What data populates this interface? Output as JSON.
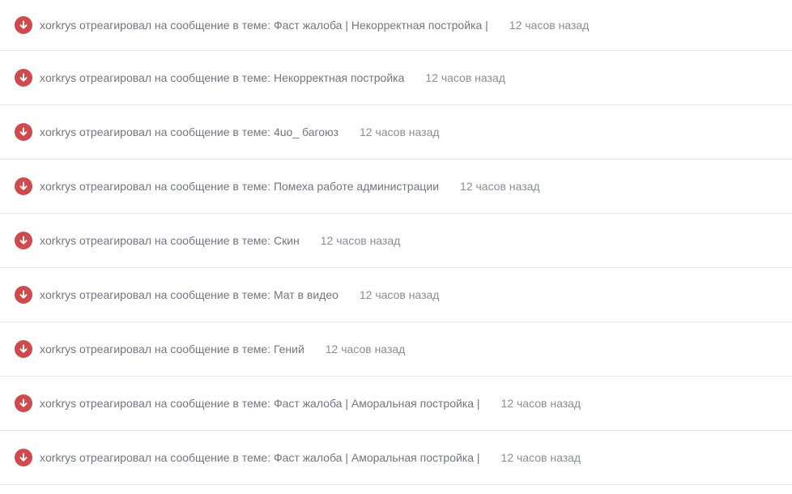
{
  "alerts": [
    {
      "icon": "down-arrow-icon",
      "text": "xorkrys отреагировал на сообщение в теме: Фаст жалоба | Некорректная постройка |",
      "time": "12 часов назад"
    },
    {
      "icon": "down-arrow-icon",
      "text": "xorkrys отреагировал на сообщение в теме: Некорректная постройка",
      "time": "12 часов назад"
    },
    {
      "icon": "down-arrow-icon",
      "text": "xorkrys отреагировал на сообщение в теме: 4uo_ багоюз",
      "time": "12 часов назад"
    },
    {
      "icon": "down-arrow-icon",
      "text": "xorkrys отреагировал на сообщение в теме: Помеха работе администрации",
      "time": "12 часов назад"
    },
    {
      "icon": "down-arrow-icon",
      "text": "xorkrys отреагировал на сообщение в теме: Скин",
      "time": "12 часов назад"
    },
    {
      "icon": "down-arrow-icon",
      "text": "xorkrys отреагировал на сообщение в теме: Мат в видео",
      "time": "12 часов назад"
    },
    {
      "icon": "down-arrow-icon",
      "text": "xorkrys отреагировал на сообщение в теме: Гений",
      "time": "12 часов назад"
    },
    {
      "icon": "down-arrow-icon",
      "text": "xorkrys отреагировал на сообщение в теме: Фаст жалоба | Аморальная постройка |",
      "time": "12 часов назад"
    },
    {
      "icon": "down-arrow-icon",
      "text": "xorkrys отреагировал на сообщение в теме: Фаст жалоба | Аморальная постройка |",
      "time": "12 часов назад"
    }
  ],
  "colors": {
    "icon_bg": "#cf4a4d",
    "divider": "#e4e6ea",
    "text": "#727583"
  }
}
